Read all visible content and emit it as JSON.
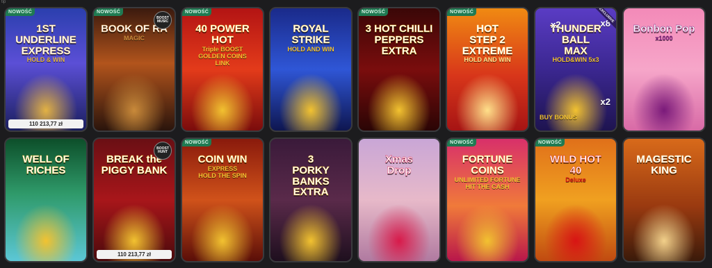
{
  "badge_label": "NOWOŚĆ",
  "corner_mark": "tip",
  "tiles": [
    {
      "title": "1ST UNDERLINE\nEXPRESS",
      "subtitle": "HOLD & WIN",
      "badge": true,
      "jackpot": "110 213,77 zł",
      "bg": "linear-gradient(180deg,#2b3fae 0%,#5b4fd6 45%,#1b1f5e 100%)",
      "accent": "#e3b244"
    },
    {
      "title": "BOOK OF RA",
      "subtitle": "MAGIC",
      "badge": true,
      "jackpot": "",
      "bg": "linear-gradient(180deg,#3b1a0e 0%,#b2541c 45%,#2a140c 100%)",
      "accent": "#c98a3a"
    },
    {
      "title": "40 POWER HOT",
      "subtitle": "Triple BOOST\nGOLDEN COINS\nLINK",
      "badge": true,
      "jackpot": "",
      "bg": "linear-gradient(180deg,#b31414 0%,#e33b1a 50%,#7a0c0c 100%)",
      "accent": "#f2c230"
    },
    {
      "title": "ROYAL\nSTRIKE",
      "subtitle": "HOLD AND WIN",
      "badge": false,
      "jackpot": "",
      "bg": "linear-gradient(180deg,#1a2a8a 0%,#2f56d6 50%,#0e1650 100%)",
      "accent": "#f2c230"
    },
    {
      "title": "3 HOT CHILLI\nPEPPERS\nEXTRA",
      "subtitle": "",
      "badge": true,
      "jackpot": "",
      "bg": "linear-gradient(180deg,#3a0707 0%,#7a0d0d 50%,#2a0505 100%)",
      "accent": "#f2c230"
    },
    {
      "title": "HOT\nSTEP 2\nEXTREME",
      "subtitle": "HOLD AND WIN",
      "badge": true,
      "jackpot": "",
      "bg": "linear-gradient(180deg,#f08a12 0%,#d8361a 55%,#a61414 100%)",
      "accent": "#ffe08a"
    },
    {
      "title": "THUNDER\nBALL\nMAX",
      "subtitle": "HOLD&WIN 5x3",
      "badge": false,
      "jackpot": "",
      "bg": "linear-gradient(180deg,#5a3cc4 0%,#3b2790 50%,#1e1450 100%)",
      "accent": "#f2c230"
    },
    {
      "title": "Bonbon Pop",
      "subtitle": "x1000",
      "badge": false,
      "jackpot": "",
      "bg": "linear-gradient(180deg,#f38ab8 0%,#f6a6c9 50%,#d86aa6 100%)",
      "accent": "#7a1a7a"
    },
    {
      "title": "WELL OF\nRICHES",
      "subtitle": "",
      "badge": false,
      "jackpot": "",
      "bg": "linear-gradient(180deg,#0d4f2a 0%,#2f9a6a 45%,#5cc7d6 100%)",
      "accent": "#f2c230"
    },
    {
      "title": "BREAK the\nPIGGY BANK",
      "subtitle": "",
      "badge": false,
      "jackpot": "110 213,77 zł",
      "bg": "linear-gradient(180deg,#6a0f14 0%,#a8161a 50%,#4a0a0c 100%)",
      "accent": "#f2c230"
    },
    {
      "title": "COIN WIN",
      "subtitle": "EXPRESS\nHOLD THE SPIN",
      "badge": true,
      "jackpot": "",
      "bg": "linear-gradient(180deg,#8a1a0c 0%,#d0521a 50%,#5a0e08 100%)",
      "accent": "#f2c230"
    },
    {
      "title": "3\nPORKY\nBANKS\nEXTRA",
      "subtitle": "",
      "badge": false,
      "jackpot": "",
      "bg": "linear-gradient(180deg,#3a1a3a 0%,#5a2a4a 50%,#1e0f1e 100%)",
      "accent": "#f2c230"
    },
    {
      "title": "Xmas\nDrop",
      "subtitle": "",
      "badge": false,
      "jackpot": "",
      "bg": "linear-gradient(180deg,#c9a6d6 0%,#e7b9c9 50%,#b07aa0 100%)",
      "accent": "#d81a4a"
    },
    {
      "title": "FORTUNE COINS",
      "subtitle": "UNLIMITED FORTUNE\nHIT THE CASH",
      "badge": true,
      "jackpot": "",
      "bg": "linear-gradient(180deg,#d8306a 0%,#f07a3a 55%,#b8164a 100%)",
      "accent": "#f2c230"
    },
    {
      "title": "WILD HOT\n40",
      "subtitle": "Deluxe",
      "badge": true,
      "jackpot": "",
      "bg": "linear-gradient(180deg,#e0701a 0%,#f0a020 50%,#c04a10 100%)",
      "accent": "#d81414"
    },
    {
      "title": "MAGESTIC\nKING",
      "subtitle": "",
      "badge": false,
      "jackpot": "",
      "bg": "linear-gradient(180deg,#d86a1a 0%,#9a3a10 55%,#3a1a0a 100%)",
      "accent": "#f2d08a"
    }
  ],
  "extras": {
    "tile2_corner": "BOOST MUSIC",
    "tile7_ribbon": "EXCLUSIVE",
    "tile7_mult_left": "x2",
    "tile7_mult_right": "x8",
    "tile7_mult_bottom": "x2",
    "tile7_bonus": "BUY BONUS",
    "tile10_corner": "BOOST HUNT",
    "tile8_mult": "x1000"
  }
}
